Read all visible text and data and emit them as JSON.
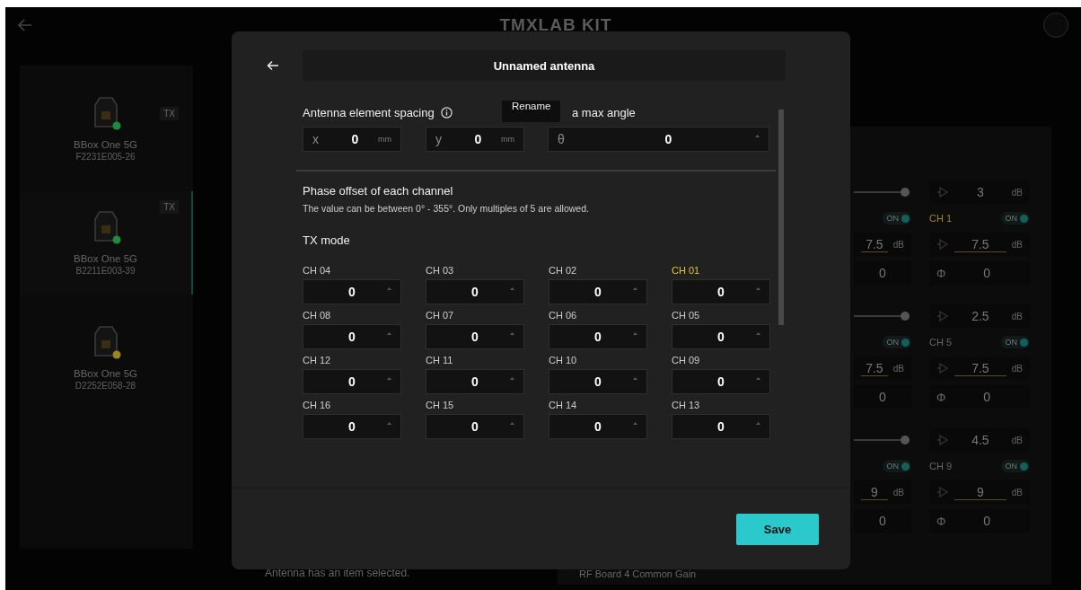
{
  "app": {
    "logo": "TMXLAB KIT"
  },
  "devices": [
    {
      "name": "BBox One 5G",
      "serial": "F2231E005-26",
      "badge": "TX",
      "color": "#1f8a3a",
      "selected": false
    },
    {
      "name": "BBox One 5G",
      "serial": "B2211E003-39",
      "badge": "TX",
      "color": "#1f8a3a",
      "selected": true
    },
    {
      "name": "BBox One 5G",
      "serial": "D2252E058-28",
      "color": "#9a8420",
      "selected": false
    }
  ],
  "board_sections": [
    {
      "level": 1,
      "gain": "3",
      "unit": "dB",
      "channels": [
        {
          "toggle": "ON",
          "value": "7.5",
          "unit": "dB",
          "phase": "0"
        },
        {
          "label": "CH 1",
          "highlighted": true,
          "toggle": "ON",
          "symbol": "Φ",
          "value": "7.5",
          "unit": "dB",
          "phase": "0"
        }
      ]
    },
    {
      "level": 1,
      "gain": "2.5",
      "unit": "dB",
      "channels": [
        {
          "toggle": "ON",
          "value": "7.5",
          "unit": "dB",
          "phase": "0"
        },
        {
          "label": "CH 5",
          "highlighted": false,
          "toggle": "ON",
          "symbol": "Φ",
          "value": "7.5",
          "unit": "dB",
          "phase": "0"
        }
      ]
    },
    {
      "level": 1,
      "gain": "4.5",
      "unit": "dB",
      "channels": [
        {
          "toggle": "ON",
          "value": "9",
          "unit": "dB",
          "phase": "0"
        },
        {
          "label": "CH 9",
          "highlighted": false,
          "toggle": "ON",
          "symbol": "Φ",
          "value": "9",
          "unit": "dB",
          "phase": "0"
        }
      ]
    }
  ],
  "next_section_title": "RF Board 4 Common Gain",
  "hint_text": "Antenna has an item selected.",
  "dialog": {
    "title": "Unnamed antenna",
    "tooltip": "Rename",
    "spacing": {
      "label": "Antenna element spacing",
      "x": {
        "prefix": "x",
        "value": "0",
        "unit": "mm"
      },
      "y": {
        "prefix": "y",
        "value": "0",
        "unit": "mm"
      }
    },
    "angle": {
      "label": "a max angle",
      "prefix": "θ",
      "value": "0"
    },
    "phase_title": "Phase offset of each channel",
    "phase_hint": "The value can be between 0° - 355°. Only multiples of 5 are allowed.",
    "mode": "TX mode",
    "channels": [
      {
        "label": "CH 04",
        "value": "0",
        "highlighted": false
      },
      {
        "label": "CH 03",
        "value": "0",
        "highlighted": false
      },
      {
        "label": "CH 02",
        "value": "0",
        "highlighted": false
      },
      {
        "label": "CH 01",
        "value": "0",
        "highlighted": true
      },
      {
        "label": "CH 08",
        "value": "0",
        "highlighted": false
      },
      {
        "label": "CH 07",
        "value": "0",
        "highlighted": false
      },
      {
        "label": "CH 06",
        "value": "0",
        "highlighted": false
      },
      {
        "label": "CH 05",
        "value": "0",
        "highlighted": false
      },
      {
        "label": "CH 12",
        "value": "0",
        "highlighted": false
      },
      {
        "label": "CH 11",
        "value": "0",
        "highlighted": false
      },
      {
        "label": "CH 10",
        "value": "0",
        "highlighted": false
      },
      {
        "label": "CH 09",
        "value": "0",
        "highlighted": false
      },
      {
        "label": "CH 16",
        "value": "0",
        "highlighted": false
      },
      {
        "label": "CH 15",
        "value": "0",
        "highlighted": false
      },
      {
        "label": "CH 14",
        "value": "0",
        "highlighted": false
      },
      {
        "label": "CH 13",
        "value": "0",
        "highlighted": false
      }
    ],
    "save": "Save"
  }
}
